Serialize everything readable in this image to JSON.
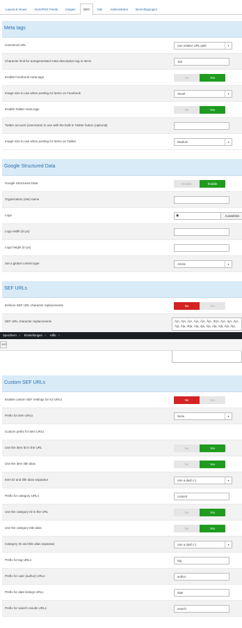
{
  "tabs": [
    "Layout & Views",
    "Atom/RSS Feeds",
    "Images",
    "SEO",
    "Site",
    "Administrator",
    "Berechtigungen"
  ],
  "active_tab": "SEO",
  "meta": {
    "title": "Meta tags",
    "canonical_label": "Canonical URL",
    "canonical_value": "Use relative URL path",
    "charlimit_label": "Character limit for autogenerated meta description tag in items",
    "charlimit_value": "150",
    "fb_label": "Enable Facebook meta tags",
    "fb_no": "No",
    "fb_yes": "Yes",
    "fbimg_label": "Image size to use when posting K2 items on Facebook",
    "fbimg_value": "Small",
    "tw_label": "Enable Twitter meta tags",
    "tw_no": "No",
    "tw_yes": "Yes",
    "twacc_label": "Twitter account (username) to use with the built-in Twitter button (optional)",
    "twimg_label": "Image size to use when posting K2 items on Twitter",
    "twimg_value": "Medium"
  },
  "gsd": {
    "title": "Google Structured Data",
    "gsd_label": "Google Structured Data",
    "gsd_disable": "Disable",
    "gsd_enable": "Enable",
    "org_label": "Organization (site) name",
    "logo_label": "Logo",
    "logo_eye": "◉",
    "logo_button": "Auswählen",
    "lw_label": "Logo width (in px)",
    "lh_label": "Logo height (in px)",
    "ct_label": "Set a global content type",
    "ct_value": "Article"
  },
  "sef": {
    "title": "SEF URLs",
    "enf_label": "Enforce SEF URL character replacements",
    "enf_no": "No",
    "enf_yes": "Yes",
    "rep_label": "SEF URL character replacements",
    "rep_line1": "À|A, Á|A, Â|A, Ã|A, Ä|A, Å|A, Æ|A, Ā|A, Ą|A, Ă|A,",
    "rep_line2": "Ä|a, Å|a, Æ|a, Ā|a, Ą|a, Ă|a, À|a, Á|a, Â|a, Ã|a,"
  },
  "toolbar": {
    "item1": "Speichern",
    "item2": "Einstellungen",
    "item3": "Hilfe",
    "sep": "×",
    "btn": "Schließen"
  },
  "custom": {
    "title": "Custom SEF URLs",
    "en_label": "Enable custom SEF settings for K2 URLs",
    "en_no": "No",
    "en_yes": "Yes",
    "item_prefix_label": "Prefix for item URLs",
    "item_prefix_value": "None",
    "custom_item_label": "Custom prefix for item URLs",
    "item_id_label": "Use the item ID in the URL",
    "item_id_no": "No",
    "item_id_yes": "Yes",
    "item_alias_label": "Use the item title alias",
    "item_alias_no": "No",
    "item_alias_yes": "Yes",
    "item_sep_label": "Item ID and title alias separator",
    "item_sep_value": "Use a dash (-)",
    "cat_prefix_label": "Prefix for category URLs",
    "cat_prefix_value": "content",
    "cat_id_label": "Use the category ID in the URL",
    "cat_id_no": "No",
    "cat_id_yes": "Yes",
    "cat_alias_label": "Use the category title alias",
    "cat_alias_no": "No",
    "cat_alias_yes": "Yes",
    "cat_sep_label": "Category ID and title alias separator",
    "cat_sep_value": "Use a dash (-)",
    "tag_label": "Prefix for tag URLs",
    "tag_value": "tag",
    "user_label": "Prefix for user (author) URLs",
    "user_value": "author",
    "date_label": "Prefix for date listings URLs",
    "date_value": "date",
    "search_label": "Prefix for search results URLs",
    "search_value": "search"
  },
  "colors": {
    "accent": "#2a6fb0",
    "section_bg": "#d9ebf7",
    "yes_green": "#1f9b1f",
    "no_red": "#d42323"
  },
  "icons": {
    "dropdown": "chevron-down-icon",
    "eye": "eye-icon"
  }
}
